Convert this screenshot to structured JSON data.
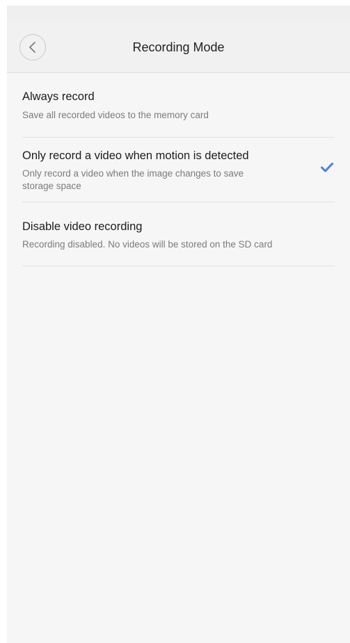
{
  "header": {
    "title": "Recording Mode"
  },
  "options": [
    {
      "title": "Always record",
      "description": "Save all recorded videos to the memory card",
      "selected": false
    },
    {
      "title": "Only record a video when motion is detected",
      "description": "Only record a video when the image changes to save storage space",
      "selected": true
    },
    {
      "title": "Disable video recording",
      "description": "Recording disabled. No videos will be stored on the SD card",
      "selected": false
    }
  ],
  "colors": {
    "accent": "#4a7fe0",
    "background": "#f6f6f6",
    "header_background": "#f1f1f1"
  },
  "icons": {
    "back": "chevron-left-icon",
    "selected": "check-icon"
  }
}
